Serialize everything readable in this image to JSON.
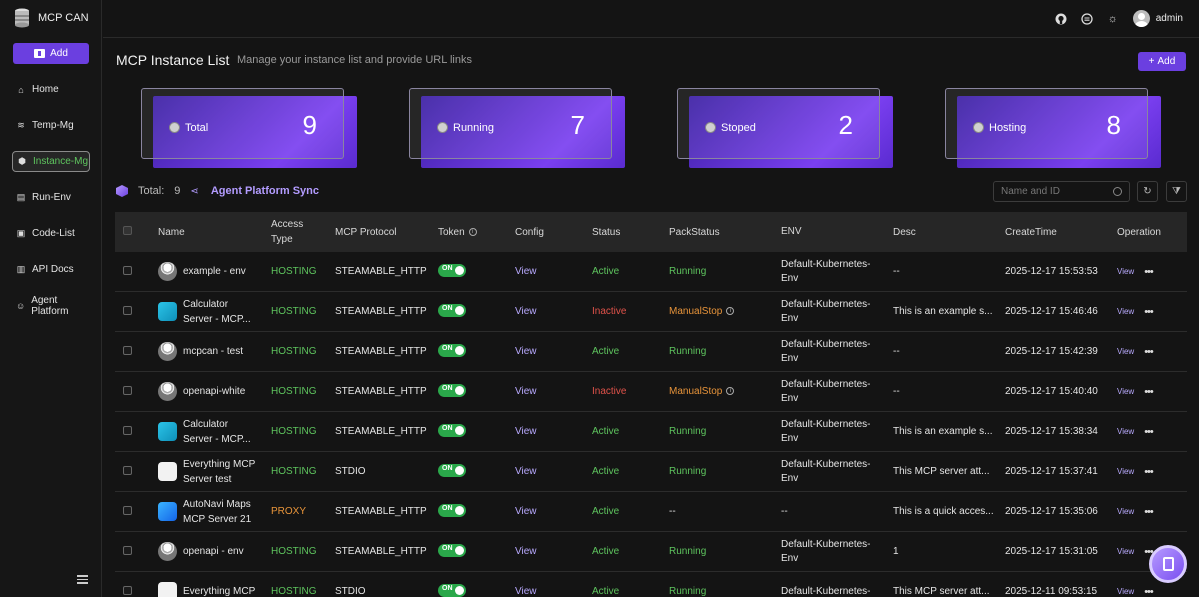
{
  "app": {
    "name": "MCP CAN",
    "add_label": "Add"
  },
  "sidebar": {
    "items": [
      {
        "label": "Home",
        "icon": "home-icon"
      },
      {
        "label": "Temp-Mg",
        "icon": "layers-icon"
      },
      {
        "label": "Instance-Mg",
        "icon": "box-icon",
        "active": true
      },
      {
        "label": "Run-Env",
        "icon": "document-icon"
      },
      {
        "label": "Code-List",
        "icon": "terminal-icon"
      },
      {
        "label": "API Docs",
        "icon": "api-doc-icon"
      },
      {
        "label": "Agent Platform",
        "icon": "robot-icon"
      }
    ]
  },
  "header": {
    "username": "admin"
  },
  "page": {
    "title": "MCP Instance List",
    "subtitle": "Manage your instance list and provide URL links",
    "add_label": "Add"
  },
  "cards": [
    {
      "label": "Total",
      "value": "9"
    },
    {
      "label": "Running",
      "value": "7"
    },
    {
      "label": "Stoped",
      "value": "2"
    },
    {
      "label": "Hosting",
      "value": "8"
    }
  ],
  "toolbar": {
    "total_label": "Total:",
    "total_value": "9",
    "sync_label": "Agent Platform Sync",
    "search_placeholder": "Name and ID"
  },
  "table": {
    "headers": {
      "name": "Name",
      "access_type": "Access\nType",
      "protocol": "MCP Protocol",
      "token": "Token",
      "config": "Config",
      "status": "Status",
      "pack": "PackStatus",
      "env": "ENV",
      "desc": "Desc",
      "time": "CreateTime",
      "op": "Operation"
    },
    "rows": [
      {
        "name": "example - env",
        "icon": "db",
        "type": "HOSTING",
        "protocol": "STEAMABLE_HTTP",
        "token": "ON",
        "config": "View",
        "status": "Active",
        "pack": "Running",
        "env": "Default-Kubernetes-\nEnv",
        "desc": "--",
        "time": "2025-12-17 15:53:53",
        "op": "View"
      },
      {
        "name": "Calculator\nServer - MCP...",
        "icon": "calc",
        "type": "HOSTING",
        "protocol": "STEAMABLE_HTTP",
        "token": "ON",
        "config": "View",
        "status": "Inactive",
        "pack": "ManualStop",
        "env": "Default-Kubernetes-\nEnv",
        "desc": "This is an example s...",
        "time": "2025-12-17 15:46:46",
        "op": "View"
      },
      {
        "name": "mcpcan - test",
        "icon": "db",
        "type": "HOSTING",
        "protocol": "STEAMABLE_HTTP",
        "token": "ON",
        "config": "View",
        "status": "Active",
        "pack": "Running",
        "env": "Default-Kubernetes-\nEnv",
        "desc": "--",
        "time": "2025-12-17 15:42:39",
        "op": "View"
      },
      {
        "name": "openapi-white",
        "icon": "db",
        "type": "HOSTING",
        "protocol": "STEAMABLE_HTTP",
        "token": "ON",
        "config": "View",
        "status": "Inactive",
        "pack": "ManualStop",
        "env": "Default-Kubernetes-\nEnv",
        "desc": "--",
        "time": "2025-12-17 15:40:40",
        "op": "View"
      },
      {
        "name": "Calculator\nServer - MCP...",
        "icon": "calc",
        "type": "HOSTING",
        "protocol": "STEAMABLE_HTTP",
        "token": "ON",
        "config": "View",
        "status": "Active",
        "pack": "Running",
        "env": "Default-Kubernetes-\nEnv",
        "desc": "This is an example s...",
        "time": "2025-12-17 15:38:34",
        "op": "View"
      },
      {
        "name": "Everything MCP\nServer test",
        "icon": "ever",
        "type": "HOSTING",
        "protocol": "STDIO",
        "token": "ON",
        "config": "View",
        "status": "Active",
        "pack": "Running",
        "env": "Default-Kubernetes-\nEnv",
        "desc": "This MCP server att...",
        "time": "2025-12-17 15:37:41",
        "op": "View"
      },
      {
        "name": "AutoNavi Maps\nMCP Server 21",
        "icon": "amap",
        "type": "PROXY",
        "protocol": "STEAMABLE_HTTP",
        "token": "ON",
        "config": "View",
        "status": "Active",
        "pack": "--",
        "env": "--",
        "desc": "This is a quick acces...",
        "time": "2025-12-17 15:35:06",
        "op": "View"
      },
      {
        "name": "openapi - env",
        "icon": "db",
        "type": "HOSTING",
        "protocol": "STEAMABLE_HTTP",
        "token": "ON",
        "config": "View",
        "status": "Active",
        "pack": "Running",
        "env": "Default-Kubernetes-\nEnv",
        "desc": "1",
        "time": "2025-12-17 15:31:05",
        "op": "View"
      },
      {
        "name": "Everything MCP",
        "icon": "ever",
        "type": "HOSTING",
        "protocol": "STDIO",
        "token": "ON",
        "config": "View",
        "status": "Active",
        "pack": "Running",
        "env": "Default-Kubernetes-",
        "desc": "This MCP server att...",
        "time": "2025-12-11 09:53:15",
        "op": "View"
      }
    ]
  },
  "colors": {
    "accent": "#6b3fe0",
    "success": "#5ec45e",
    "warning": "#e8943a",
    "danger": "#e0524a",
    "link": "#b9aaff"
  }
}
